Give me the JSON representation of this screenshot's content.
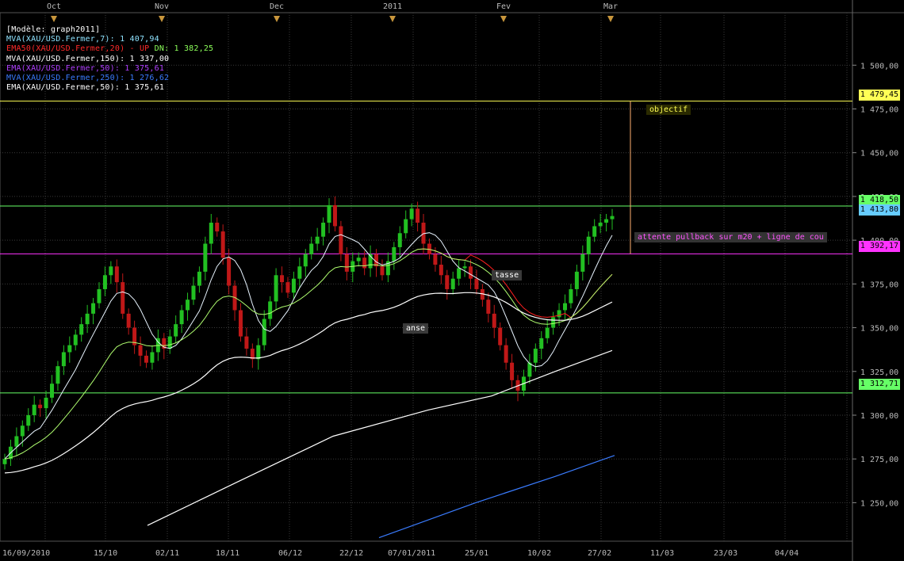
{
  "chart_data": {
    "type": "candlestick",
    "months_top": [
      "Oct",
      "Nov",
      "Dec",
      "2011",
      "Fev",
      "Mar"
    ],
    "x_ticks": [
      "16/09/2010",
      "15/10",
      "02/11",
      "18/11",
      "06/12",
      "22/12",
      "07/01/2011",
      "25/01",
      "10/02",
      "27/02",
      "11/03",
      "23/03",
      "04/04"
    ],
    "y_ticks": [
      "1 250,00",
      "1 275,00",
      "1 300,00",
      "1 325,00",
      "1 350,00",
      "1 375,00",
      "1 400,00",
      "1 425,00",
      "1 450,00",
      "1 475,00",
      "1 500,00"
    ],
    "ylim": [
      1228,
      1530
    ],
    "legend": [
      {
        "text": "[Modèle: graph2011]",
        "color": "#ffffff"
      },
      {
        "text": "MVA(XAU/USD.Fermer,7): 1 407,94",
        "color": "#8fe3ff"
      },
      {
        "text": "EMA50(XAU/USD.Fermer,20) - UP",
        "color": "#ff2a2a",
        "extra": " DN: 1 382,25",
        "extra_color": "#8cff5a"
      },
      {
        "text": "MVA(XAU/USD.Fermer,150): 1 337,00",
        "color": "#ffffff"
      },
      {
        "text": "EMA(XAU/USD.Fermer,50): 1 375,61",
        "color": "#b040ff"
      },
      {
        "text": "MVA(XAU/USD.Fermer,250): 1 276,62",
        "color": "#3a7cff"
      },
      {
        "text": "EMA(XAU/USD.Fermer,50): 1 375,61",
        "color": "#ffffff"
      }
    ],
    "levels": [
      {
        "value": 1479.45,
        "label": "1 479,45",
        "color": "#ffff55"
      },
      {
        "value": 1419.5,
        "label": "1 418,50",
        "color": "#66ff66"
      },
      {
        "value": 1413.8,
        "label": "1 413,80",
        "color": "#66ccff"
      },
      {
        "value": 1392.17,
        "label": "1 392,17",
        "color": "#ff33ff"
      },
      {
        "value": 1312.71,
        "label": "1 312,71",
        "color": "#66ff66"
      }
    ],
    "annotations": [
      {
        "text": "objectif",
        "style": "yellow"
      },
      {
        "text": "attente pullback sur m20 + ligne de cou",
        "style": "magenta"
      },
      {
        "text": "tasse",
        "style": "gray"
      },
      {
        "text": "anse",
        "style": "gray"
      }
    ],
    "closes": [
      1275,
      1282,
      1288,
      1294,
      1300,
      1306,
      1304,
      1310,
      1318,
      1328,
      1336,
      1340,
      1346,
      1352,
      1358,
      1364,
      1372,
      1380,
      1385,
      1376,
      1358,
      1350,
      1340,
      1334,
      1330,
      1336,
      1344,
      1338,
      1345,
      1352,
      1360,
      1366,
      1374,
      1382,
      1398,
      1410,
      1405,
      1390,
      1374,
      1360,
      1345,
      1338,
      1332,
      1340,
      1355,
      1365,
      1380,
      1376,
      1370,
      1378,
      1385,
      1392,
      1398,
      1402,
      1410,
      1420,
      1408,
      1392,
      1382,
      1388,
      1390,
      1384,
      1392,
      1385,
      1380,
      1388,
      1396,
      1404,
      1412,
      1418,
      1410,
      1398,
      1392,
      1386,
      1380,
      1372,
      1378,
      1384,
      1385,
      1378,
      1372,
      1366,
      1358,
      1350,
      1340,
      1330,
      1320,
      1314,
      1322,
      1330,
      1338,
      1344,
      1350,
      1356,
      1360,
      1364,
      1372,
      1382,
      1392,
      1402,
      1408,
      1410,
      1412,
      1413.8
    ]
  }
}
